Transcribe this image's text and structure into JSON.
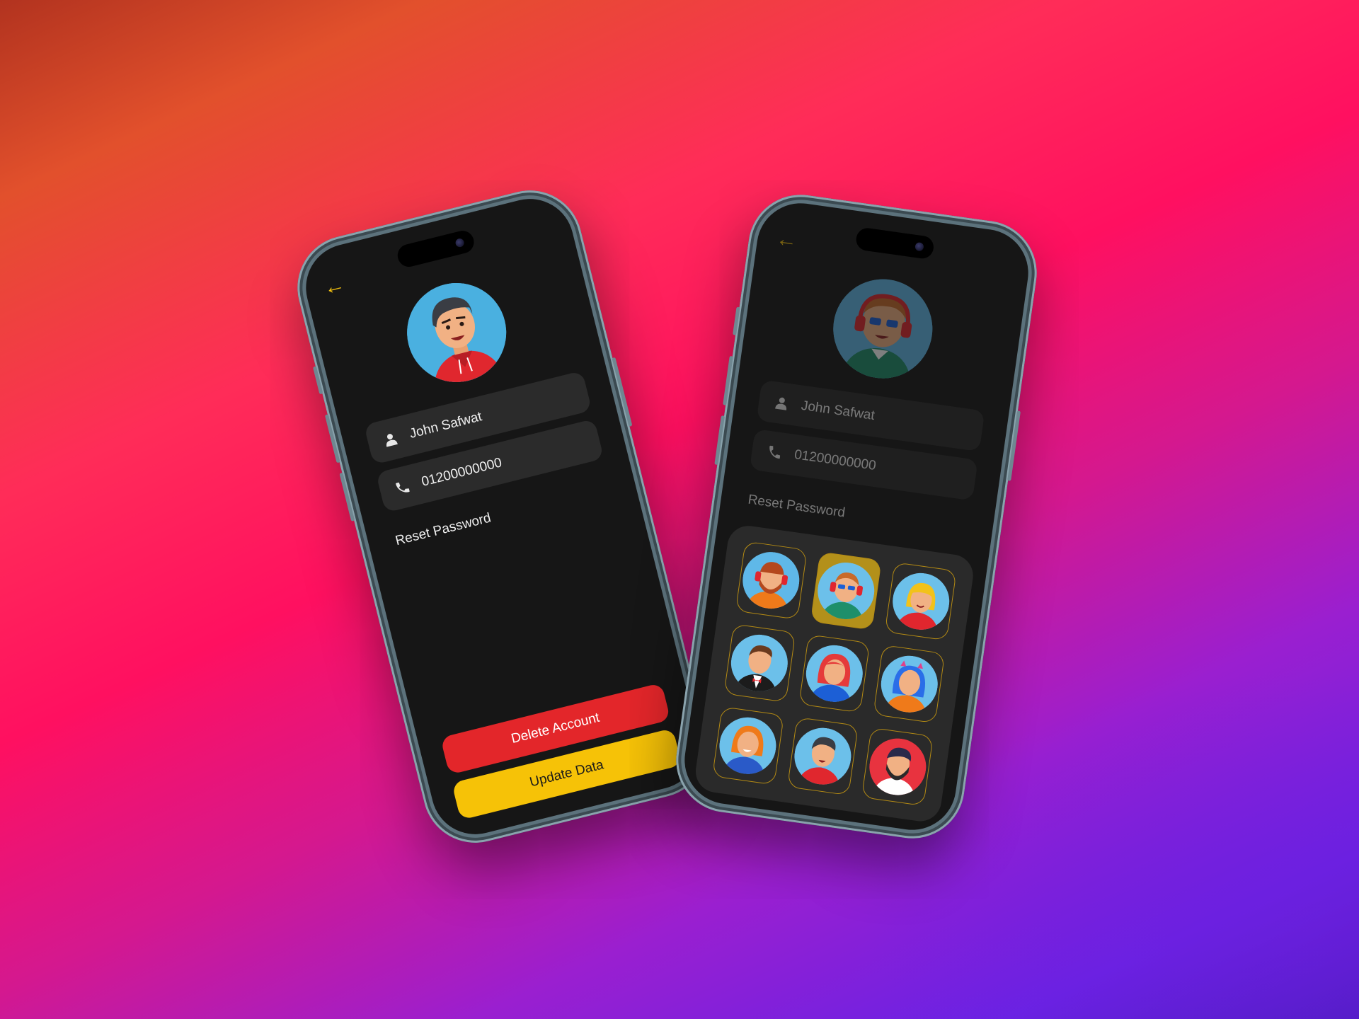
{
  "profile_screen": {
    "back_icon": "arrow-left-icon",
    "name": "John Safwat",
    "phone": "01200000000",
    "reset_password": "Reset Password",
    "delete_button": "Delete Account",
    "update_button": "Update Data"
  },
  "avatar_picker_screen": {
    "back_icon": "arrow-left-icon",
    "name": "John Safwat",
    "phone": "01200000000",
    "reset_password": "Reset Password",
    "avatars": [
      {
        "icon": "avatar-bearded-headphones",
        "bg": "#5fb8e8",
        "selected": false
      },
      {
        "icon": "avatar-sunglasses-headphones",
        "bg": "#6cc0ea",
        "selected": true
      },
      {
        "icon": "avatar-blonde-woman",
        "bg": "#6cc0ea",
        "selected": false
      },
      {
        "icon": "avatar-tuxedo-man",
        "bg": "#6cc0ea",
        "selected": false
      },
      {
        "icon": "avatar-red-hair-woman",
        "bg": "#6cc0ea",
        "selected": false
      },
      {
        "icon": "avatar-blue-hair-girl",
        "bg": "#6cc0ea",
        "selected": false
      },
      {
        "icon": "avatar-ginger-woman",
        "bg": "#6cc0ea",
        "selected": false
      },
      {
        "icon": "avatar-hoodie-man",
        "bg": "#6cc0ea",
        "selected": false
      },
      {
        "icon": "avatar-bearded-man-red",
        "bg": "#e8333f",
        "selected": false
      }
    ]
  },
  "colors": {
    "accent": "#f6c207",
    "danger": "#e3262a",
    "screen_bg": "#161616",
    "field_bg": "#2b2b2b"
  }
}
